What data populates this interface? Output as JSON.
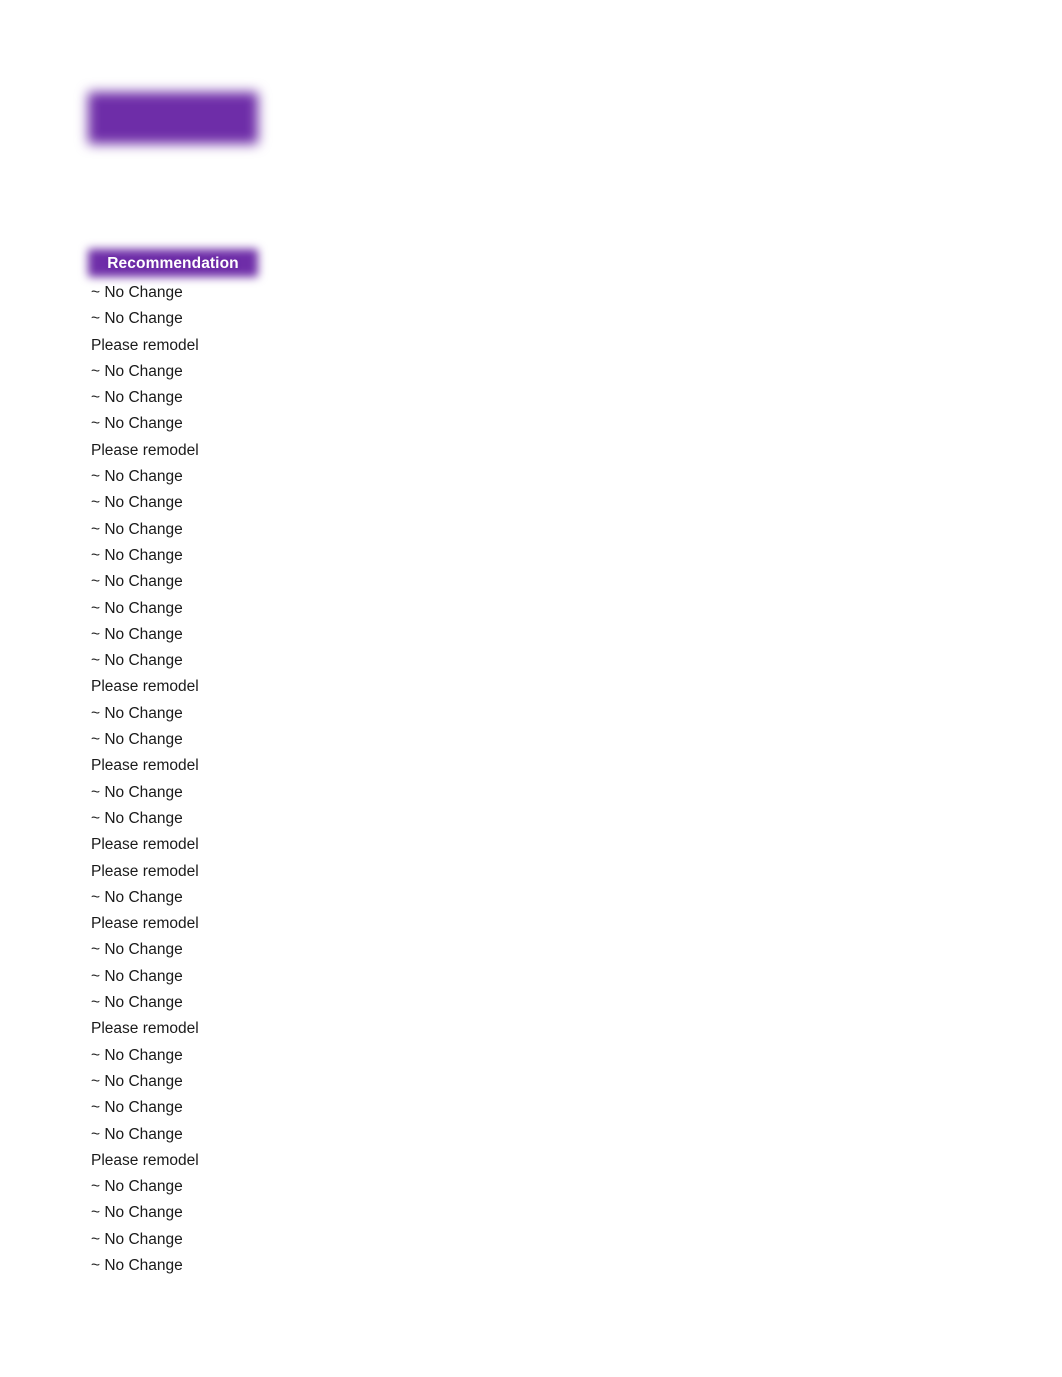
{
  "document": {
    "background_color": "#ffffff",
    "accent_color": "#6E2DA8",
    "text_color": "#1a1a1a"
  },
  "title_banner": {
    "label": "",
    "fill_color": "#6E2DA8",
    "blurred": true
  },
  "column": {
    "header": "Recommendation",
    "header_fill": "#6E2DA8",
    "header_text_color": "#FFFFFF"
  },
  "values": {
    "no_change": "~ No Change",
    "please_remodel": "Please remodel"
  },
  "rows": [
    {
      "recommendation": "~ No Change"
    },
    {
      "recommendation": "~ No Change"
    },
    {
      "recommendation": "Please remodel"
    },
    {
      "recommendation": "~ No Change"
    },
    {
      "recommendation": "~ No Change"
    },
    {
      "recommendation": "~ No Change"
    },
    {
      "recommendation": "Please remodel"
    },
    {
      "recommendation": "~ No Change"
    },
    {
      "recommendation": "~ No Change"
    },
    {
      "recommendation": "~ No Change"
    },
    {
      "recommendation": "~ No Change"
    },
    {
      "recommendation": "~ No Change"
    },
    {
      "recommendation": "~ No Change"
    },
    {
      "recommendation": "~ No Change"
    },
    {
      "recommendation": "~ No Change"
    },
    {
      "recommendation": "Please remodel"
    },
    {
      "recommendation": "~ No Change"
    },
    {
      "recommendation": "~ No Change"
    },
    {
      "recommendation": "Please remodel"
    },
    {
      "recommendation": "~ No Change"
    },
    {
      "recommendation": "~ No Change"
    },
    {
      "recommendation": "Please remodel"
    },
    {
      "recommendation": "Please remodel"
    },
    {
      "recommendation": "~ No Change"
    },
    {
      "recommendation": "Please remodel"
    },
    {
      "recommendation": "~ No Change"
    },
    {
      "recommendation": "~ No Change"
    },
    {
      "recommendation": "~ No Change"
    },
    {
      "recommendation": "Please remodel"
    },
    {
      "recommendation": "~ No Change"
    },
    {
      "recommendation": "~ No Change"
    },
    {
      "recommendation": "~ No Change"
    },
    {
      "recommendation": "~ No Change"
    },
    {
      "recommendation": "Please remodel"
    },
    {
      "recommendation": "~ No Change"
    },
    {
      "recommendation": "~ No Change"
    },
    {
      "recommendation": "~ No Change"
    },
    {
      "recommendation": "~ No Change"
    }
  ],
  "summary": {
    "total_rows": 38,
    "no_change_count": 29,
    "please_remodel_count": 9
  }
}
